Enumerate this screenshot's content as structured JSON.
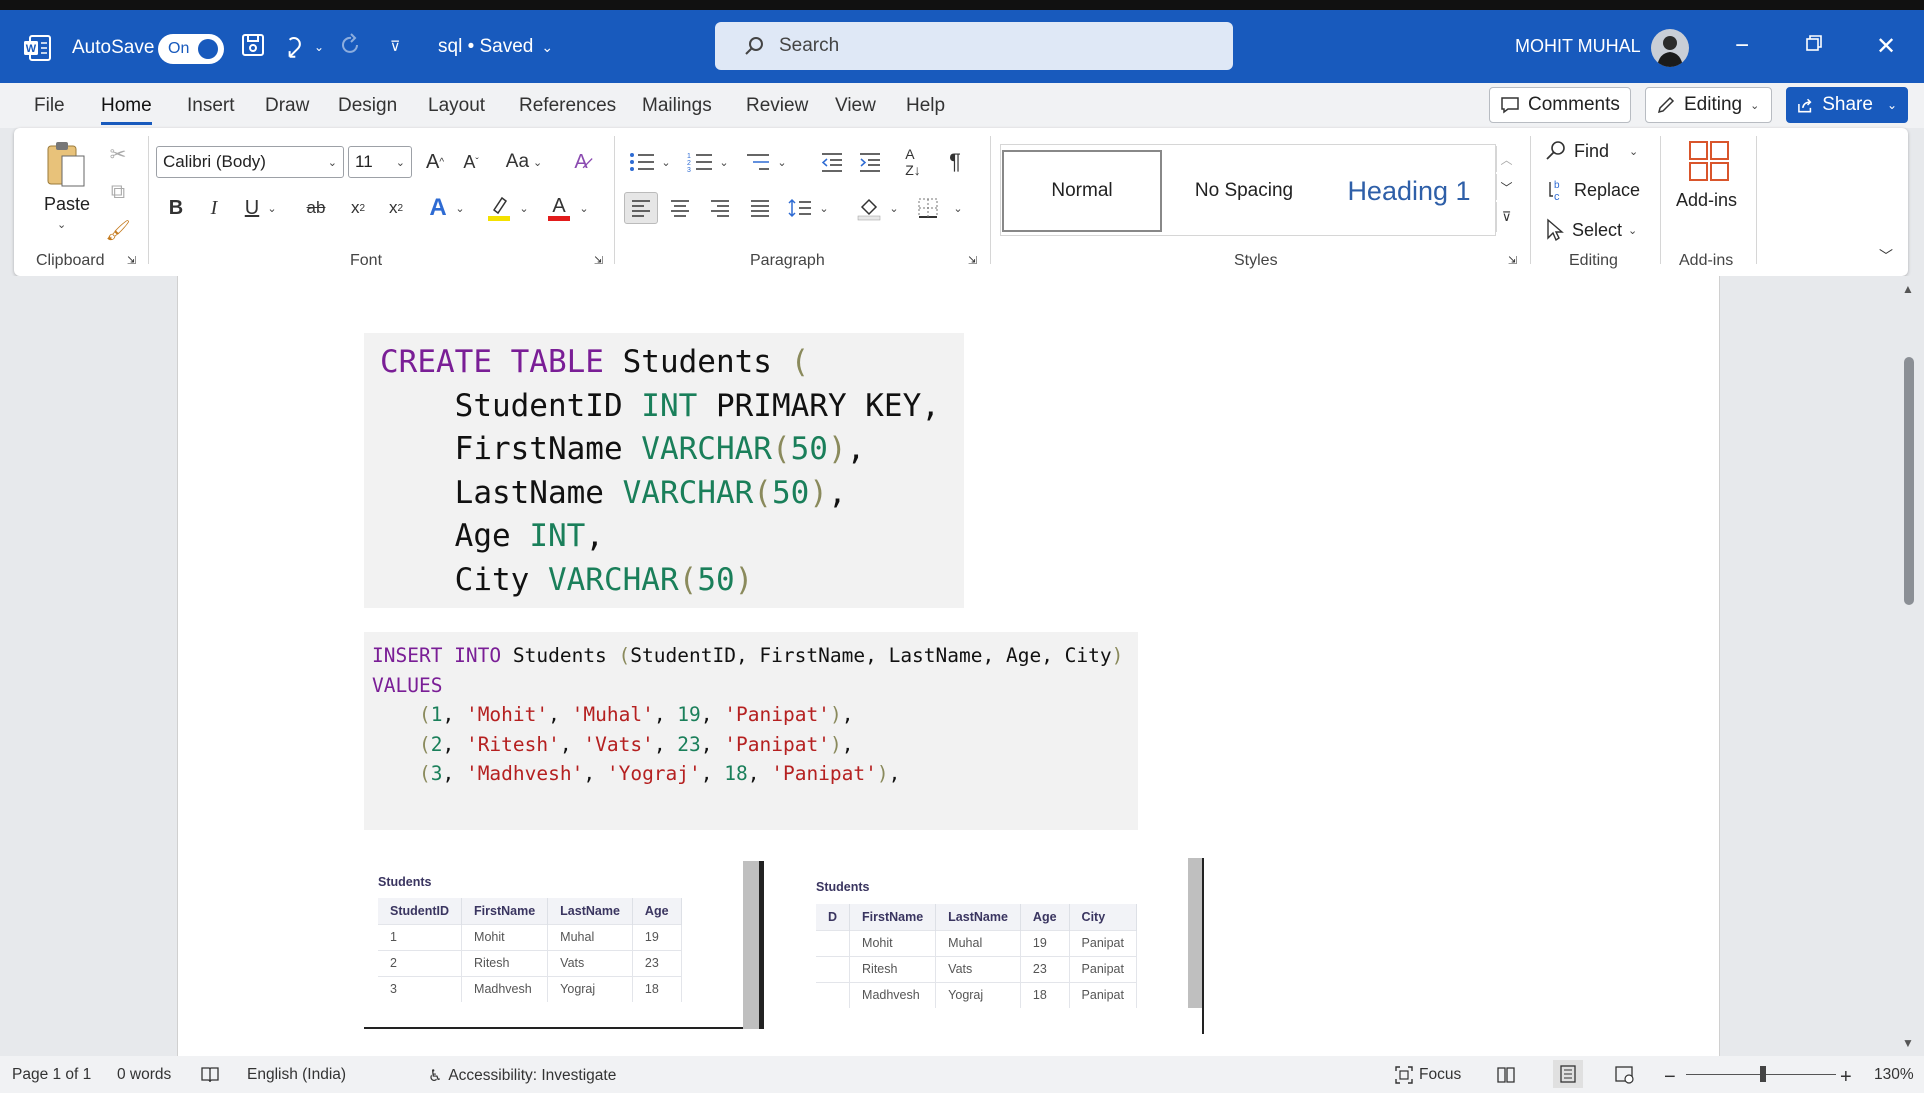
{
  "titlebar": {
    "autosave_label": "AutoSave",
    "autosave_state": "On",
    "doc_title": "sql • Saved",
    "search_placeholder": "Search",
    "user_name": "MOHIT MUHAL"
  },
  "menu": {
    "tabs": [
      "File",
      "Home",
      "Insert",
      "Draw",
      "Design",
      "Layout",
      "References",
      "Mailings",
      "Review",
      "View",
      "Help"
    ],
    "active_tab": "Home",
    "comments_label": "Comments",
    "editing_label": "Editing",
    "share_label": "Share"
  },
  "ribbon": {
    "clipboard": {
      "paste_label": "Paste",
      "group_label": "Clipboard"
    },
    "font": {
      "font_name": "Calibri (Body)",
      "font_size": "11",
      "group_label": "Font",
      "case_label": "Aa"
    },
    "paragraph": {
      "group_label": "Paragraph"
    },
    "styles": {
      "items": [
        "Normal",
        "No Spacing",
        "Heading 1"
      ],
      "group_label": "Styles"
    },
    "editing": {
      "find_label": "Find",
      "replace_label": "Replace",
      "select_label": "Select",
      "group_label": "Editing"
    },
    "addins": {
      "label": "Add-ins",
      "group_label": "Add-ins"
    }
  },
  "document": {
    "code_create": [
      [
        {
          "t": "CREATE TABLE",
          "c": "kw"
        },
        {
          "t": " Students ",
          "c": ""
        },
        {
          "t": "(",
          "c": "pn"
        }
      ],
      [
        {
          "t": "    StudentID ",
          "c": ""
        },
        {
          "t": "INT",
          "c": "ty"
        },
        {
          "t": " PRIMARY KEY,",
          "c": ""
        }
      ],
      [
        {
          "t": "    FirstName ",
          "c": ""
        },
        {
          "t": "VARCHAR",
          "c": "ty"
        },
        {
          "t": "(",
          "c": "pn"
        },
        {
          "t": "50",
          "c": "nm"
        },
        {
          "t": ")",
          "c": "pn"
        },
        {
          "t": ",",
          "c": ""
        }
      ],
      [
        {
          "t": "    LastName ",
          "c": ""
        },
        {
          "t": "VARCHAR",
          "c": "ty"
        },
        {
          "t": "(",
          "c": "pn"
        },
        {
          "t": "50",
          "c": "nm"
        },
        {
          "t": ")",
          "c": "pn"
        },
        {
          "t": ",",
          "c": ""
        }
      ],
      [
        {
          "t": "    Age ",
          "c": ""
        },
        {
          "t": "INT",
          "c": "ty"
        },
        {
          "t": ",",
          "c": ""
        }
      ],
      [
        {
          "t": "    City ",
          "c": ""
        },
        {
          "t": "VARCHAR",
          "c": "ty"
        },
        {
          "t": "(",
          "c": "pn"
        },
        {
          "t": "50",
          "c": "nm"
        },
        {
          "t": ")",
          "c": "pn"
        }
      ]
    ],
    "code_insert": [
      [
        {
          "t": "INSERT INTO",
          "c": "kw"
        },
        {
          "t": " Students ",
          "c": ""
        },
        {
          "t": "(",
          "c": "pn"
        },
        {
          "t": "StudentID, FirstName, LastName, Age, City",
          "c": ""
        },
        {
          "t": ")",
          "c": "pn"
        }
      ],
      [
        {
          "t": "VALUES",
          "c": "kw"
        }
      ],
      [
        {
          "t": "    ",
          "c": ""
        },
        {
          "t": "(",
          "c": "pn"
        },
        {
          "t": "1",
          "c": "nm"
        },
        {
          "t": ", ",
          "c": ""
        },
        {
          "t": "'Mohit'",
          "c": "st"
        },
        {
          "t": ", ",
          "c": ""
        },
        {
          "t": "'Muhal'",
          "c": "st"
        },
        {
          "t": ", ",
          "c": ""
        },
        {
          "t": "19",
          "c": "nm"
        },
        {
          "t": ", ",
          "c": ""
        },
        {
          "t": "'Panipat'",
          "c": "st"
        },
        {
          "t": ")",
          "c": "pn"
        },
        {
          "t": ",",
          "c": ""
        }
      ],
      [
        {
          "t": "    ",
          "c": ""
        },
        {
          "t": "(",
          "c": "pn"
        },
        {
          "t": "2",
          "c": "nm"
        },
        {
          "t": ", ",
          "c": ""
        },
        {
          "t": "'Ritesh'",
          "c": "st"
        },
        {
          "t": ", ",
          "c": ""
        },
        {
          "t": "'Vats'",
          "c": "st"
        },
        {
          "t": ", ",
          "c": ""
        },
        {
          "t": "23",
          "c": "nm"
        },
        {
          "t": ", ",
          "c": ""
        },
        {
          "t": "'Panipat'",
          "c": "st"
        },
        {
          "t": ")",
          "c": "pn"
        },
        {
          "t": ",",
          "c": ""
        }
      ],
      [
        {
          "t": "    ",
          "c": ""
        },
        {
          "t": "(",
          "c": "pn"
        },
        {
          "t": "3",
          "c": "nm"
        },
        {
          "t": ", ",
          "c": ""
        },
        {
          "t": "'Madhvesh'",
          "c": "st"
        },
        {
          "t": ", ",
          "c": ""
        },
        {
          "t": "'Yograj'",
          "c": "st"
        },
        {
          "t": ", ",
          "c": ""
        },
        {
          "t": "18",
          "c": "nm"
        },
        {
          "t": ", ",
          "c": ""
        },
        {
          "t": "'Panipat'",
          "c": "st"
        },
        {
          "t": ")",
          "c": "pn"
        },
        {
          "t": ",",
          "c": ""
        }
      ]
    ],
    "table_left": {
      "caption": "Students",
      "headers": [
        "StudentID",
        "FirstName",
        "LastName",
        "Age"
      ],
      "rows": [
        [
          "1",
          "Mohit",
          "Muhal",
          "19"
        ],
        [
          "2",
          "Ritesh",
          "Vats",
          "23"
        ],
        [
          "3",
          "Madhvesh",
          "Yograj",
          "18"
        ]
      ]
    },
    "table_right": {
      "caption": "Students",
      "headers": [
        "D",
        "FirstName",
        "LastName",
        "Age",
        "City"
      ],
      "rows": [
        [
          "",
          "Mohit",
          "Muhal",
          "19",
          "Panipat"
        ],
        [
          "",
          "Ritesh",
          "Vats",
          "23",
          "Panipat"
        ],
        [
          "",
          "Madhvesh",
          "Yograj",
          "18",
          "Panipat"
        ]
      ]
    }
  },
  "statusbar": {
    "page": "Page 1 of 1",
    "words": "0 words",
    "language": "English (India)",
    "accessibility": "Accessibility: Investigate",
    "focus": "Focus",
    "zoom": "130%"
  },
  "colors": {
    "brand": "#185abd",
    "keyword": "#7a1e96",
    "type": "#1a7f5a",
    "string": "#b52020"
  }
}
